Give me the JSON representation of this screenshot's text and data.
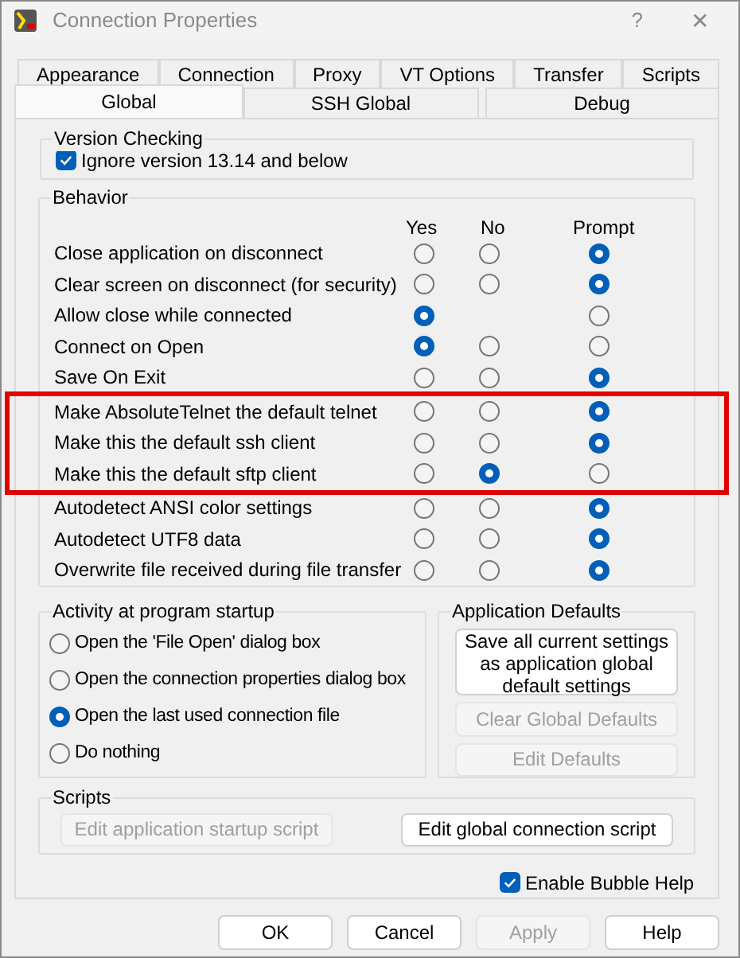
{
  "window": {
    "title": "Connection Properties",
    "help": "?",
    "close": "✕"
  },
  "tabs": [
    [
      {
        "label": "Appearance",
        "selected": false
      },
      {
        "label": "Connection",
        "selected": false
      },
      {
        "label": "Proxy",
        "selected": false
      },
      {
        "label": "VT Options",
        "selected": false
      },
      {
        "label": "Transfer",
        "selected": false
      },
      {
        "label": "Scripts",
        "selected": false
      }
    ],
    [
      {
        "label": "Global",
        "selected": true
      },
      {
        "label": "SSH Global",
        "selected": false
      },
      {
        "label": "Debug",
        "selected": false
      }
    ]
  ],
  "version_checking": {
    "title": "Version Checking",
    "label": "Ignore version 13.14 and below",
    "checked": true
  },
  "behavior": {
    "title": "Behavior",
    "columns": [
      "Yes",
      "No",
      "Prompt"
    ],
    "rows": [
      {
        "label": "Close application on disconnect",
        "highlighted": false,
        "options": [
          {
            "kind": "yes",
            "selected": false
          },
          {
            "kind": "no",
            "selected": false
          },
          {
            "kind": "prompt",
            "selected": true
          }
        ]
      },
      {
        "label": "Clear screen on disconnect (for security)",
        "highlighted": false,
        "options": [
          {
            "kind": "yes",
            "selected": false
          },
          {
            "kind": "no",
            "selected": false
          },
          {
            "kind": "prompt",
            "selected": true
          }
        ]
      },
      {
        "label": "Allow close while connected",
        "highlighted": false,
        "options": [
          {
            "kind": "yes",
            "selected": true
          },
          {
            "kind": "prompt",
            "selected": false
          }
        ]
      },
      {
        "label": "Connect on Open",
        "highlighted": false,
        "options": [
          {
            "kind": "yes",
            "selected": true
          },
          {
            "kind": "no",
            "selected": false
          },
          {
            "kind": "prompt",
            "selected": false
          }
        ]
      },
      {
        "label": "Save On Exit",
        "highlighted": false,
        "options": [
          {
            "kind": "yes",
            "selected": false
          },
          {
            "kind": "no",
            "selected": false
          },
          {
            "kind": "prompt",
            "selected": true
          }
        ]
      },
      {
        "label": "Make AbsoluteTelnet the default telnet",
        "highlighted": true,
        "options": [
          {
            "kind": "yes",
            "selected": false
          },
          {
            "kind": "no",
            "selected": false
          },
          {
            "kind": "prompt",
            "selected": true
          }
        ]
      },
      {
        "label": "Make this the default ssh client",
        "highlighted": true,
        "options": [
          {
            "kind": "yes",
            "selected": false
          },
          {
            "kind": "no",
            "selected": false
          },
          {
            "kind": "prompt",
            "selected": true
          }
        ]
      },
      {
        "label": "Make this the default sftp client",
        "highlighted": true,
        "options": [
          {
            "kind": "yes",
            "selected": false
          },
          {
            "kind": "no",
            "selected": true
          },
          {
            "kind": "prompt",
            "selected": false
          }
        ]
      },
      {
        "label": "Autodetect ANSI color settings",
        "highlighted": false,
        "options": [
          {
            "kind": "yes",
            "selected": false
          },
          {
            "kind": "no",
            "selected": false
          },
          {
            "kind": "prompt",
            "selected": true
          }
        ]
      },
      {
        "label": "Autodetect UTF8 data",
        "highlighted": false,
        "options": [
          {
            "kind": "yes",
            "selected": false
          },
          {
            "kind": "no",
            "selected": false
          },
          {
            "kind": "prompt",
            "selected": true
          }
        ]
      },
      {
        "label": "Overwrite file received during file transfer",
        "highlighted": false,
        "options": [
          {
            "kind": "yes",
            "selected": false
          },
          {
            "kind": "no",
            "selected": false
          },
          {
            "kind": "prompt",
            "selected": true
          }
        ]
      }
    ]
  },
  "startup": {
    "title": "Activity at program startup",
    "options": [
      {
        "label": "Open the 'File Open' dialog box",
        "selected": false
      },
      {
        "label": "Open the connection properties dialog box",
        "selected": false
      },
      {
        "label": "Open the last used connection file",
        "selected": true
      },
      {
        "label": "Do nothing",
        "selected": false
      }
    ]
  },
  "app_defaults": {
    "title": "Application Defaults",
    "buttons": [
      {
        "label": "Save all current settings as application global default settings",
        "disabled": false
      },
      {
        "label": "Clear Global Defaults",
        "disabled": true
      },
      {
        "label": "Edit Defaults",
        "disabled": true
      }
    ]
  },
  "scripts": {
    "title": "Scripts",
    "buttons": [
      {
        "label": "Edit application startup script",
        "disabled": true
      },
      {
        "label": "Edit global connection script",
        "disabled": false
      }
    ]
  },
  "bubble_help": {
    "label": "Enable Bubble Help",
    "checked": true
  },
  "buttons": [
    {
      "label": "OK",
      "disabled": false
    },
    {
      "label": "Cancel",
      "disabled": false
    },
    {
      "label": "Apply",
      "disabled": true
    },
    {
      "label": "Help",
      "disabled": false
    }
  ]
}
